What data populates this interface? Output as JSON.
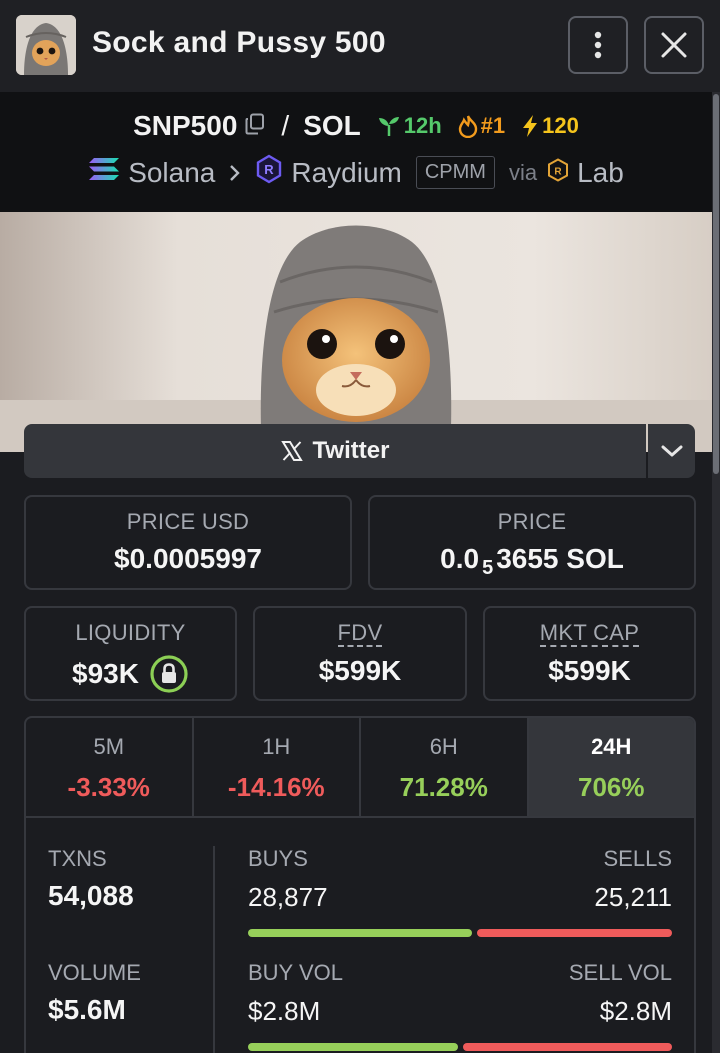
{
  "header": {
    "title": "Sock and Pussy 500"
  },
  "pair": {
    "base": "SNP500",
    "slash": "/",
    "quote": "SOL",
    "age": "12h",
    "rank": "#1",
    "boosts": "120",
    "chain": "Solana",
    "dex": "Raydium",
    "pool_type": "CPMM",
    "via": "via",
    "launchpad": "Lab"
  },
  "social": {
    "twitter_label": "Twitter"
  },
  "stats": {
    "price_usd_label": "PRICE USD",
    "price_usd": "$0.0005997",
    "price_label": "PRICE",
    "price_sol_lead": "0.0",
    "price_sol_zeros": "5",
    "price_sol_tail": "3655 SOL",
    "liquidity_label": "LIQUIDITY",
    "liquidity": "$93K",
    "fdv_label": "FDV",
    "fdv": "$599K",
    "mktcap_label": "MKT CAP",
    "mktcap": "$599K"
  },
  "timeframes": [
    {
      "label": "5M",
      "change": "-3.33%",
      "trend": "negative"
    },
    {
      "label": "1H",
      "change": "-14.16%",
      "trend": "negative"
    },
    {
      "label": "6H",
      "change": "71.28%",
      "trend": "positive"
    },
    {
      "label": "24H",
      "change": "706%",
      "trend": "positive",
      "active": true
    }
  ],
  "activity": {
    "txns_label": "TXNS",
    "txns": "54,088",
    "buys_label": "BUYS",
    "buys": "28,877",
    "sells_label": "SELLS",
    "sells": "25,211",
    "buy_share": 0.534,
    "volume_label": "VOLUME",
    "volume": "$5.6M",
    "buy_vol_label": "BUY VOL",
    "buy_vol": "$2.8M",
    "sell_vol_label": "SELL VOL",
    "sell_vol": "$2.8M",
    "buy_vol_share": 0.5
  },
  "colors": {
    "positive": "#97cf5a",
    "negative": "#ef5b5b",
    "age_badge": "#55c96b",
    "rank_badge": "#f29b1d",
    "boost_badge": "#f5c41c"
  }
}
